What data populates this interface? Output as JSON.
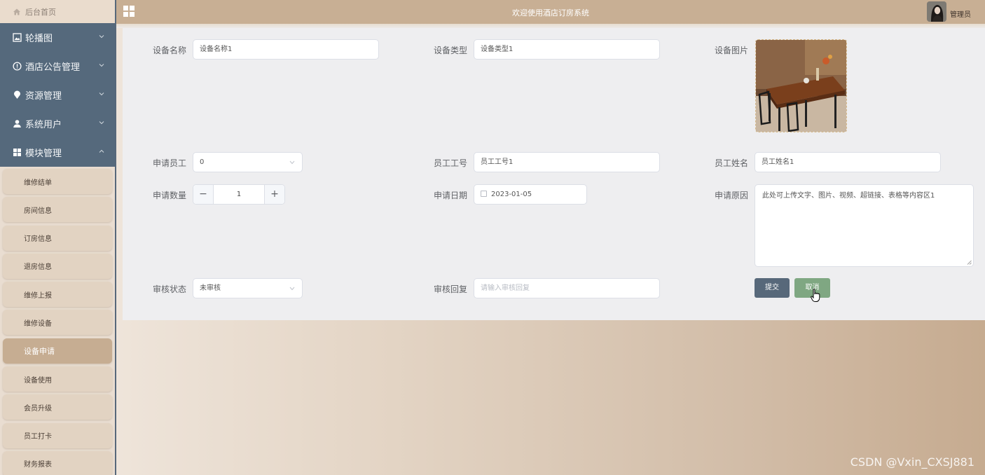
{
  "sidebar": {
    "home": "后台首页",
    "menus": [
      {
        "label": "轮播图",
        "icon": "image-icon"
      },
      {
        "label": "酒店公告管理",
        "icon": "info-icon"
      },
      {
        "label": "资源管理",
        "icon": "location-icon"
      },
      {
        "label": "系统用户",
        "icon": "user-icon"
      },
      {
        "label": "模块管理",
        "icon": "grid-icon"
      }
    ],
    "sub_items": [
      {
        "label": "维修结单"
      },
      {
        "label": "房间信息"
      },
      {
        "label": "订房信息"
      },
      {
        "label": "退房信息"
      },
      {
        "label": "维修上报"
      },
      {
        "label": "维修设备"
      },
      {
        "label": "设备申请",
        "active": true
      },
      {
        "label": "设备使用"
      },
      {
        "label": "会员升级"
      },
      {
        "label": "员工打卡"
      },
      {
        "label": "财务报表"
      }
    ]
  },
  "header": {
    "title": "欢迎使用酒店订房系统",
    "user": "管理员"
  },
  "form": {
    "device_name": {
      "label": "设备名称",
      "value": "设备名称1"
    },
    "device_type": {
      "label": "设备类型",
      "value": "设备类型1"
    },
    "device_image": {
      "label": "设备图片"
    },
    "applicant": {
      "label": "申请员工",
      "value": "0"
    },
    "employee_no": {
      "label": "员工工号",
      "value": "员工工号1"
    },
    "employee_name": {
      "label": "员工姓名",
      "value": "员工姓名1"
    },
    "quantity": {
      "label": "申请数量",
      "value": "1",
      "minus": "−",
      "plus": "+"
    },
    "apply_date": {
      "label": "申请日期",
      "value": "2023-01-05"
    },
    "reason": {
      "label": "申请原因",
      "value": "此处可上传文字、图片、视频、超链接、表格等内容区1"
    },
    "review_status": {
      "label": "审核状态",
      "value": "未审核"
    },
    "review_reply": {
      "label": "审核回复",
      "placeholder": "请输入审核回复"
    },
    "submit": "提交",
    "cancel": "取消"
  },
  "watermark": "CSDN @Vxin_CXSJ881",
  "colors": {
    "sidebar_dark": "#55697c",
    "topbar": "#c8af94",
    "submit": "#57687a",
    "cancel": "#7fa782",
    "active_sub": "#c6ad92"
  }
}
